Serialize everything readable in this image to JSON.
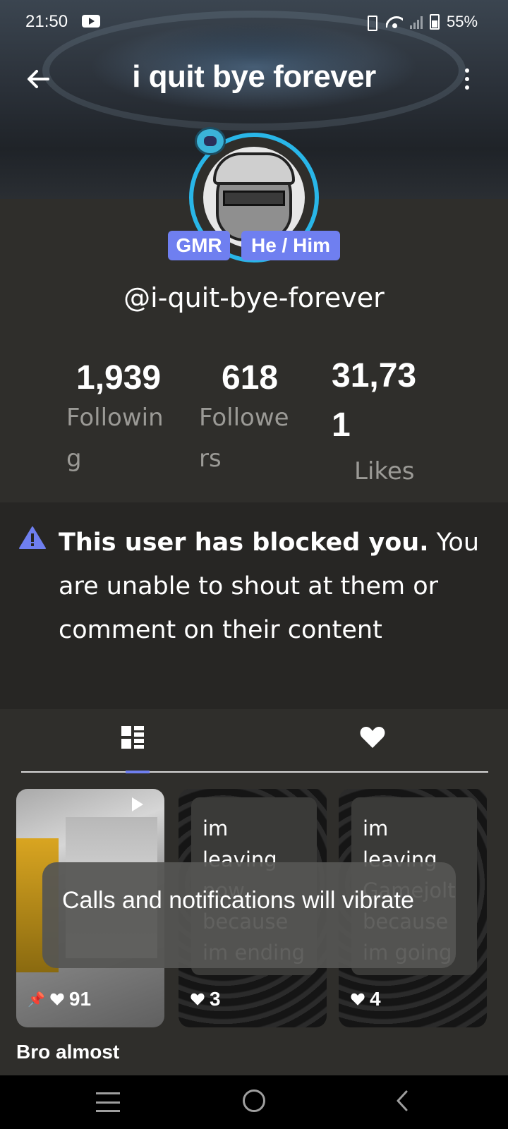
{
  "status_bar": {
    "time": "21:50",
    "battery": "55%"
  },
  "header": {
    "title": "i quit bye forever",
    "back_icon": "arrow-left-icon",
    "more_icon": "more-vert-icon"
  },
  "profile": {
    "tags": [
      "GMR",
      "He / Him"
    ],
    "handle": "@i-quit-bye-forever",
    "stats": {
      "following": {
        "value": "1,939",
        "label_line1": "Followin",
        "label_line2": "g"
      },
      "followers": {
        "value": "618",
        "label_line1": "Followe",
        "label_line2": "rs"
      },
      "likes": {
        "value_line1": "31,73",
        "value_line2": "1",
        "label": "Likes"
      }
    },
    "accent_color": "#6f7ff0",
    "avatar_ring_color": "#29b6e8"
  },
  "blocked_notice": {
    "bold": "This user has blocked you.",
    "message": "You are unable to shout at them or comment on their content"
  },
  "tabs": [
    {
      "name": "posts",
      "icon": "dashboard-icon",
      "active": true
    },
    {
      "name": "liked",
      "icon": "heart-icon",
      "active": false
    }
  ],
  "posts": [
    {
      "type": "video",
      "pinned": true,
      "likes": "91",
      "caption": "Bro almost"
    },
    {
      "type": "text",
      "text": "im leaving now because im ending",
      "likes": "3"
    },
    {
      "type": "text",
      "text": "im leaving Gamejolt because im going",
      "likes": "4"
    }
  ],
  "toast": {
    "text": "Calls and notifications will vibrate"
  },
  "nav_bar": {
    "icons": [
      "menu-icon",
      "home-icon",
      "back-icon"
    ]
  }
}
